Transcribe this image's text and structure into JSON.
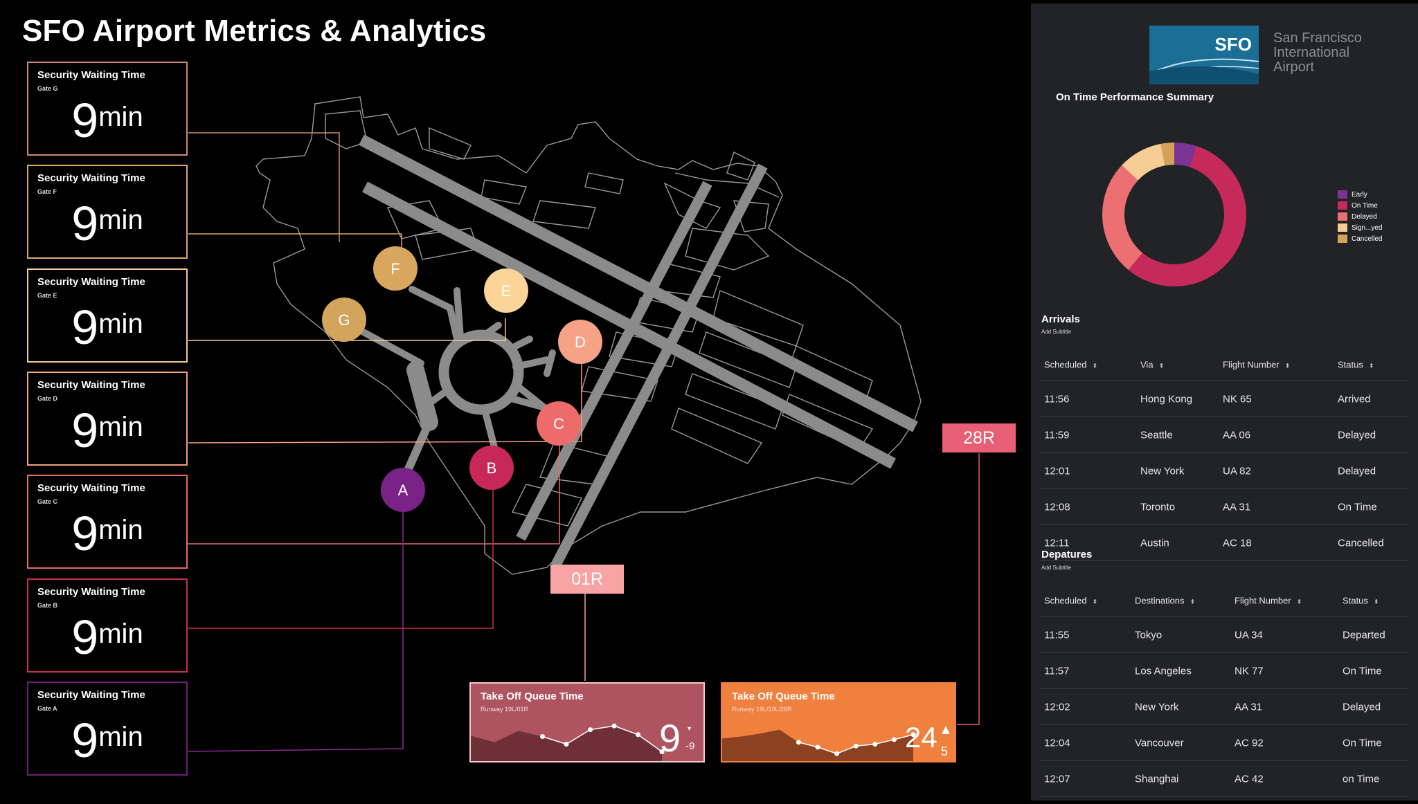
{
  "title": "SFO Airport Metrics & Analytics",
  "security_cards": [
    {
      "label": "Security Waiting Time",
      "gate": "Gate G",
      "value": "9",
      "unit": "min",
      "color": "#c98b72"
    },
    {
      "label": "Security Waiting Time",
      "gate": "Gate F",
      "value": "9",
      "unit": "min",
      "color": "#d7a86e"
    },
    {
      "label": "Security Waiting Time",
      "gate": "Gate E",
      "value": "9",
      "unit": "min",
      "color": "#f2cc8f"
    },
    {
      "label": "Security Waiting Time",
      "gate": "Gate D",
      "value": "9",
      "unit": "min",
      "color": "#f2a07e"
    },
    {
      "label": "Security Waiting Time",
      "gate": "Gate C",
      "value": "9",
      "unit": "min",
      "color": "#e26a6a"
    },
    {
      "label": "Security Waiting Time",
      "gate": "Gate B",
      "value": "9",
      "unit": "min",
      "color": "#c2334d"
    },
    {
      "label": "Security Waiting Time",
      "gate": "Gate A",
      "value": "9",
      "unit": "min",
      "color": "#6e1f78"
    }
  ],
  "gates": [
    {
      "letter": "F",
      "color": "#d9a660"
    },
    {
      "letter": "G",
      "color": "#d2a45c"
    },
    {
      "letter": "E",
      "color": "#fbd597"
    },
    {
      "letter": "D",
      "color": "#f5a287"
    },
    {
      "letter": "C",
      "color": "#ee6b6b"
    },
    {
      "letter": "B",
      "color": "#c8275a"
    },
    {
      "letter": "A",
      "color": "#7a2387"
    }
  ],
  "runways": [
    {
      "label": "01R",
      "color": "#f8a4a4"
    },
    {
      "label": "28R",
      "color": "#e85e74"
    }
  ],
  "takeoff": [
    {
      "title": "Take Off Queue Time",
      "runway": "Runway 19L/01R",
      "value": "9",
      "delta": "-9",
      "arrow": "down",
      "bg": "#ae5360",
      "fill": "#6e2f36",
      "border": "#f3c9c9",
      "points": [
        0.52,
        0.35,
        0.65,
        0.5,
        0.3,
        0.68,
        0.78,
        0.55,
        0.1
      ]
    },
    {
      "title": "Take Off Queue Time",
      "runway": "Runway 19L/10L/28R",
      "value": "24",
      "delta": "5",
      "arrow": "up",
      "bg": "#f0803e",
      "fill": "#8c4220",
      "border": "#f0803e",
      "points": [
        0.45,
        0.5,
        0.58,
        0.68,
        0.35,
        0.22,
        0.05,
        0.25,
        0.3,
        0.42,
        0.55
      ]
    }
  ],
  "panel": {
    "logo_code": "SFO",
    "logo_words": [
      "San Francisco",
      "International",
      "Airport"
    ],
    "summary_title": "On Time Performance Summary"
  },
  "chart_data": {
    "type": "pie",
    "title": "On Time Performance Summary",
    "labels": [
      "Early",
      "On Time",
      "Delayed",
      "Sign...yed",
      "Cancelled"
    ],
    "values": [
      5,
      56,
      26,
      10,
      3
    ],
    "colors": [
      "#7c3393",
      "#c62a5b",
      "#ec6f72",
      "#f6cd94",
      "#d6a25a"
    ]
  },
  "arrivals": {
    "title": "Arrivals",
    "subtitle": "Add Subtitle",
    "columns": [
      "Scheduled",
      "Via",
      "Flight Number",
      "Status"
    ],
    "rows": [
      [
        "11:56",
        "Hong Kong",
        "NK 65",
        "Arrived"
      ],
      [
        "11:59",
        "Seattle",
        "AA 06",
        "Delayed"
      ],
      [
        "12:01",
        "New York",
        "UA 82",
        "Delayed"
      ],
      [
        "12:08",
        "Toronto",
        "AA 31",
        "On Time"
      ],
      [
        "12:11",
        "Austin",
        "AC 18",
        "Cancelled"
      ]
    ]
  },
  "departures": {
    "title": "Depatures",
    "subtitle": "Add Subtitle",
    "columns": [
      "Scheduled",
      "Destinations",
      "Flight Number",
      "Status"
    ],
    "rows": [
      [
        "11:55",
        "Tokyo",
        "UA 34",
        "Departed"
      ],
      [
        "11:57",
        "Los Angeles",
        "NK 77",
        "On Time"
      ],
      [
        "12:02",
        "New York",
        "AA 31",
        "Delayed"
      ],
      [
        "12:04",
        "Vancouver",
        "AC 92",
        "On Time"
      ],
      [
        "12:07",
        "Shanghai",
        "AC 42",
        "on Time"
      ]
    ]
  }
}
